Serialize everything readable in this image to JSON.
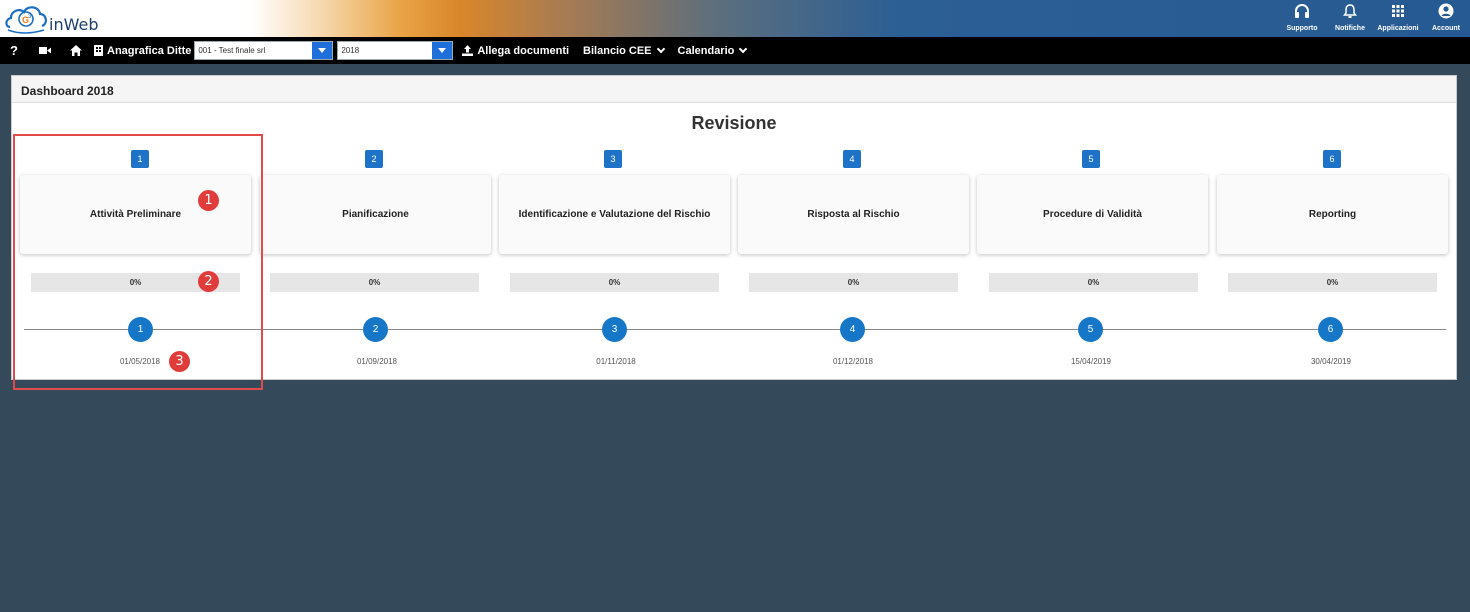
{
  "app": {
    "name": "inWeb"
  },
  "top_actions": [
    {
      "label": "Supporto",
      "icon": "headset-icon"
    },
    {
      "label": "Notifiche",
      "icon": "bell-icon"
    },
    {
      "label": "Applicazioni",
      "icon": "apps-grid-icon"
    },
    {
      "label": "Account",
      "icon": "user-circle-icon"
    }
  ],
  "navbar": {
    "help": "?",
    "anagrafica_label": "Anagrafica Ditte",
    "company_select": "001 - Test finale srl",
    "year_select": "2018",
    "allega_label": "Allega documenti",
    "bilancio_label": "Bilancio CEE",
    "calendario_label": "Calendario"
  },
  "panel": {
    "header": "Dashboard 2018",
    "title": "Revisione"
  },
  "phases": [
    {
      "step": "1",
      "name": "Attività Preliminare",
      "progress": "0%",
      "date": "01/05/2018"
    },
    {
      "step": "2",
      "name": "Pianificazione",
      "progress": "0%",
      "date": "01/09/2018"
    },
    {
      "step": "3",
      "name": "Identificazione e Valutazione del Rischio",
      "progress": "0%",
      "date": "01/11/2018"
    },
    {
      "step": "4",
      "name": "Risposta al Rischio",
      "progress": "0%",
      "date": "01/12/2018"
    },
    {
      "step": "5",
      "name": "Procedure di Validità",
      "progress": "0%",
      "date": "15/04/2019"
    },
    {
      "step": "6",
      "name": "Reporting",
      "progress": "0%",
      "date": "30/04/2019"
    }
  ],
  "callouts": [
    "1",
    "2",
    "3"
  ],
  "colors": {
    "accent": "#1e73c8",
    "callout": "#e03c3c",
    "background": "#34495a"
  }
}
